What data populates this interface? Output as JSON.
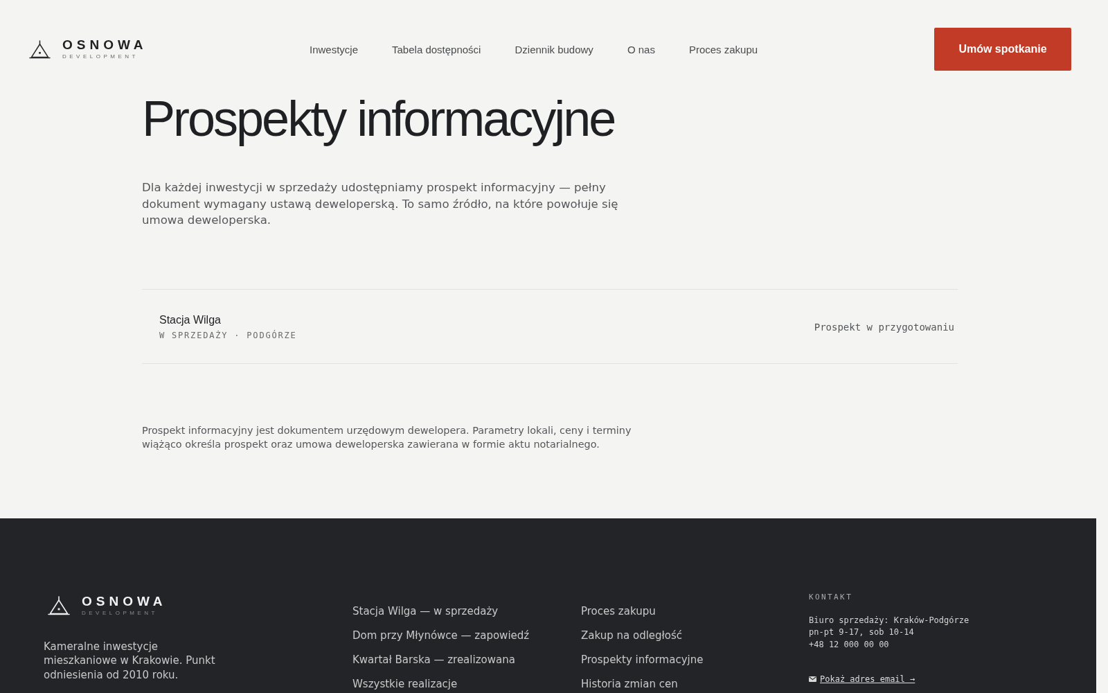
{
  "header": {
    "logo": {
      "name": "OSNOWA",
      "tagline": "DEVELOPMENT"
    },
    "nav": [
      "Inwestycje",
      "Tabela dostępności",
      "Dziennik budowy",
      "O nas",
      "Proces zakupu"
    ],
    "cta_button": "Umów spotkanie"
  },
  "main": {
    "title": "Prospekty informacyjne",
    "intro": "Dla każdej inwestycji w sprzedaży udostępniamy prospekt informacyjny — pełny dokument wymagany ustawą deweloperską. To samo źródło, na które powołuje się umowa deweloperska.",
    "prospects": [
      {
        "name": "Stacja Wilga",
        "meta": "W SPRZEDAŻY · PODGÓRZE",
        "status": "Prospekt w przygotowaniu"
      }
    ],
    "note": "Prospekt informacyjny jest dokumentem urzędowym dewelopera. Parametry lokali, ceny i terminy wiążąco określa prospekt oraz umowa deweloperska zawierana w formie aktu notarialnego."
  },
  "footer": {
    "logo": {
      "name": "OSNOWA",
      "tagline": "DEVELOPMENT"
    },
    "description": "Kameralne inwestycje mieszkaniowe w Krakowie. Punkt odniesienia od 2010 roku.",
    "columns": [
      {
        "links": [
          "Stacja Wilga — w sprzedaży",
          "Dom przy Młynówce — zapowiedź",
          "Kwartał Barska — zrealizowana",
          "Wszystkie realizacje"
        ]
      },
      {
        "links": [
          "Proces zakupu",
          "Zakup na odległość",
          "Prospekty informacyjne",
          "Historia zmian cen"
        ]
      }
    ],
    "contact": {
      "heading": "KONTAKT",
      "lines": [
        "Biuro sprzedaży: Kraków-Podgórze",
        "pn-pt 9-17, sob 10-14",
        "+48 12 000 00 00"
      ],
      "email_link": "Pokaż adres email →"
    }
  }
}
